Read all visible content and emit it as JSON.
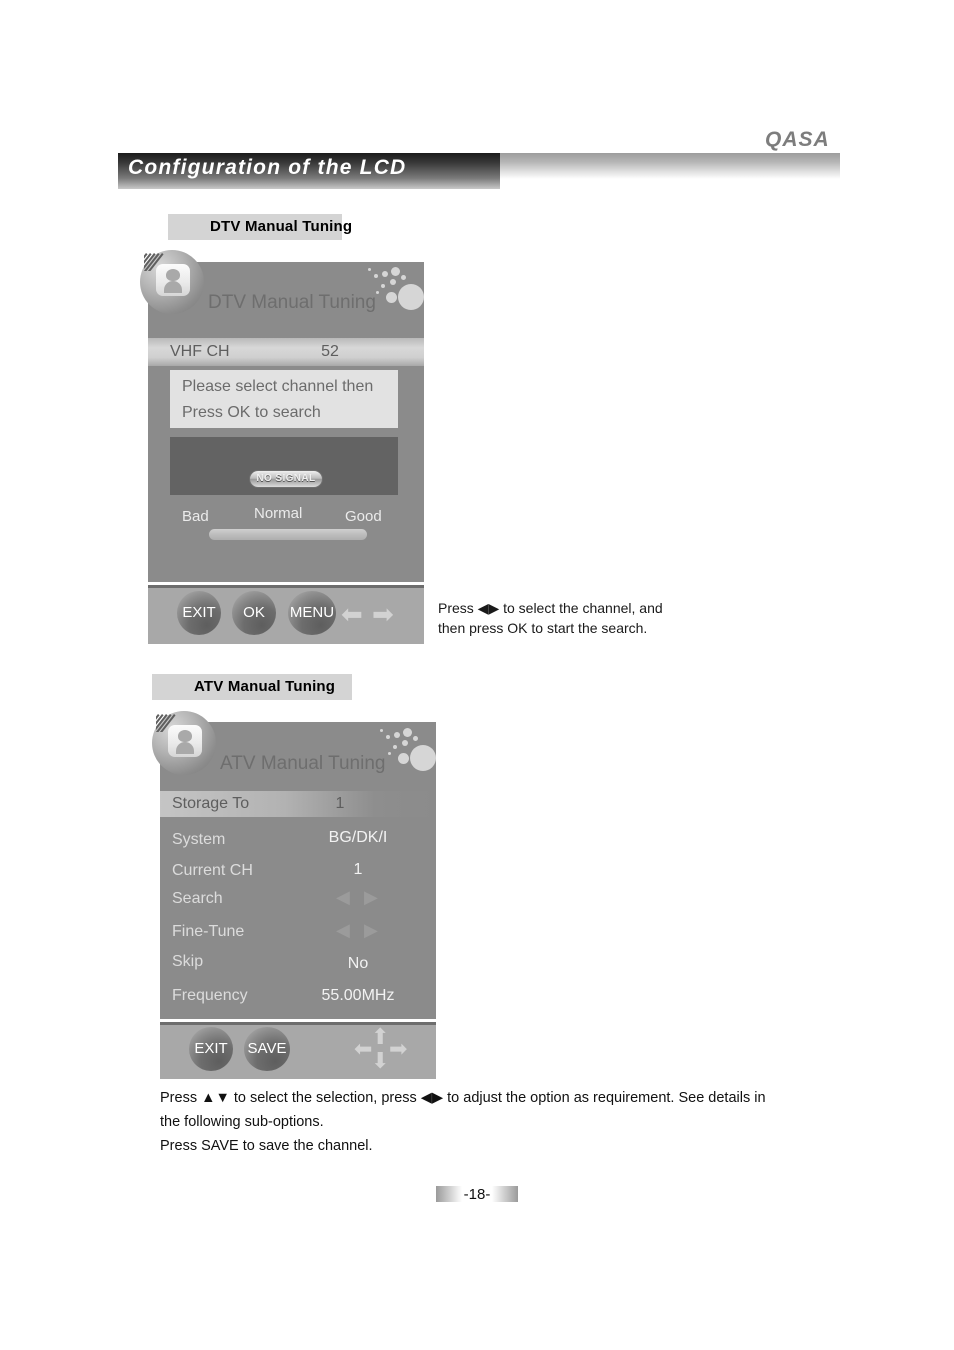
{
  "brand": "QASA",
  "header": {
    "title": "Configuration of the LCD"
  },
  "sections": [
    {
      "label": "DTV Manual Tuning"
    },
    {
      "label": "ATV Manual Tuning"
    }
  ],
  "dtv_panel": {
    "icon": "broadcast-tv-icon",
    "title": "DTV Manual Tuning",
    "channel_row": {
      "label": "VHF  CH",
      "value": "52"
    },
    "message_line1": "Please select channel then",
    "message_line2": "Press OK to search",
    "signal_badge": "NO SIGNAL",
    "meter": {
      "bad": "Bad",
      "normal": "Normal",
      "good": "Good"
    },
    "buttons": [
      "EXIT",
      "OK",
      "MENU"
    ],
    "arrows": [
      "left-arrow-icon",
      "right-arrow-icon"
    ]
  },
  "dtv_note": {
    "line1": "Press ◀▶  to select the channel, and",
    "line2": "then press  OK to start the search."
  },
  "atv_panel": {
    "icon": "broadcast-tv-icon",
    "title": "ATV Manual Tuning",
    "highlight_row": {
      "label": "Storage To",
      "value": "1"
    },
    "rows": [
      {
        "label": "System",
        "value": "BG/DK/I",
        "type": "text"
      },
      {
        "label": "Current CH",
        "value": "1",
        "type": "text"
      },
      {
        "label": "Search",
        "value": "",
        "type": "arrows"
      },
      {
        "label": "Fine-Tune",
        "value": "",
        "type": "arrows"
      },
      {
        "label": "Skip",
        "value": "No",
        "type": "text"
      },
      {
        "label": "Frequency",
        "value": "55.00MHz",
        "type": "text"
      }
    ],
    "buttons": [
      "EXIT",
      "SAVE"
    ],
    "dpad": [
      "left-arrow-icon",
      "up-arrow-icon",
      "down-arrow-icon",
      "right-arrow-icon"
    ]
  },
  "atv_note": {
    "line1": "Press ▲▼ to select the selection, press ◀▶ to adjust the option as requirement.  See details in",
    "line2": "the following sub-options.",
    "line3": "Press SAVE to save the channel."
  },
  "footer": {
    "page": "-18-"
  },
  "colors": {
    "panel_bg": "#8b8b8b",
    "panel_bar": "#a8a8a8",
    "chip_bg": "#d4d4d4",
    "preview_bg": "#636363",
    "msg_bg": "#e2e2e2"
  }
}
